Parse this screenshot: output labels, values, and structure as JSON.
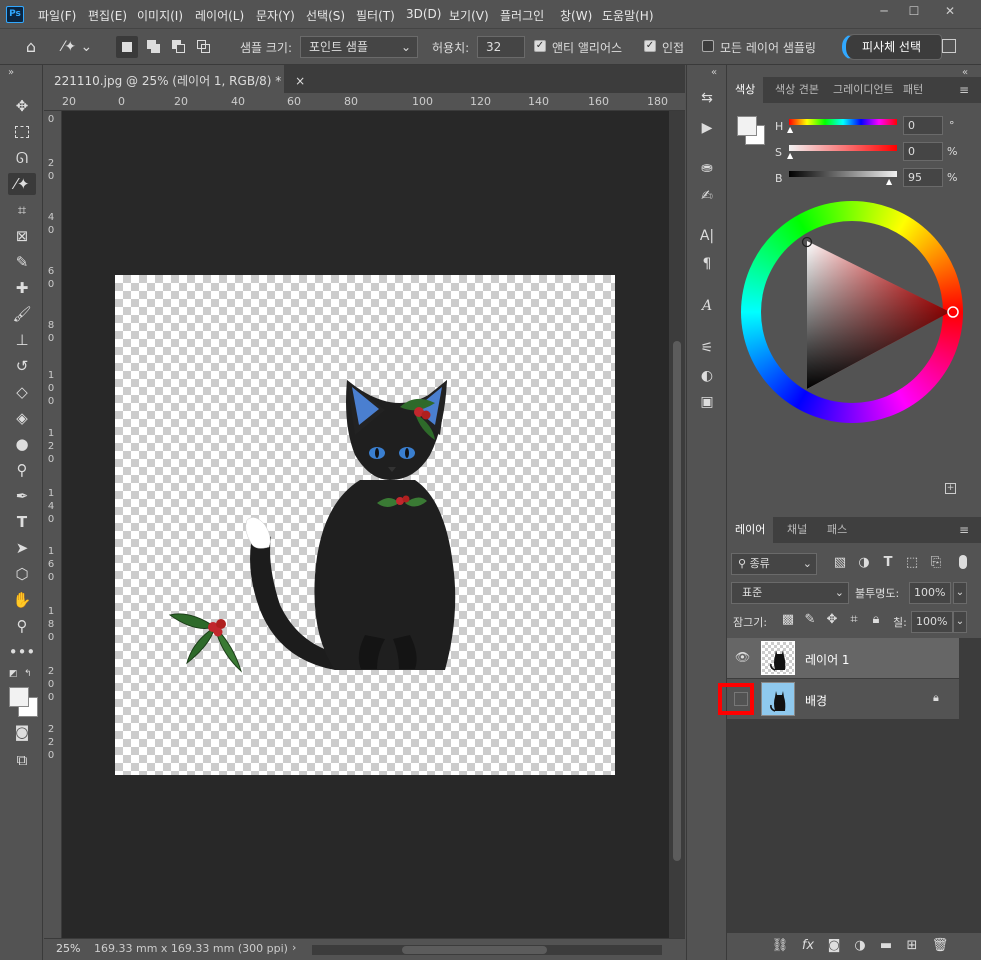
{
  "app": {
    "logo": "Ps"
  },
  "menu": [
    "파일(F)",
    "편집(E)",
    "이미지(I)",
    "레이어(L)",
    "문자(Y)",
    "선택(S)",
    "필터(T)",
    "3D(D)",
    "보기(V)",
    "플러그인",
    "창(W)",
    "도움말(H)"
  ],
  "window_controls": {
    "minimize": "─",
    "maximize": "☐",
    "close": "✕"
  },
  "options": {
    "sample_size_label": "샘플 크기:",
    "sample_size_value": "포인트 샘플",
    "tolerance_label": "허용치:",
    "tolerance_value": "32",
    "antialias_label": "앤티 앨리어스",
    "antialias_checked": true,
    "contiguous_label": "인접",
    "contiguous_checked": true,
    "sample_all_label": "모든 레이어 샘플링",
    "sample_all_checked": false,
    "subject_select_label": "피사체 선택"
  },
  "document": {
    "tab_title": "221110.jpg @ 25% (레이어 1, RGB/8) *",
    "close": "×",
    "zoom": "25%",
    "doc_size": "169.33 mm x 169.33 mm (300 ppi)"
  },
  "ruler_h": [
    "20",
    "0",
    "20",
    "40",
    "60",
    "80",
    "100",
    "120",
    "140",
    "160",
    "180"
  ],
  "ruler_v": [
    "0",
    "2\n0",
    "4\n0",
    "6\n0",
    "8\n0",
    "1\n0\n0",
    "1\n2\n0",
    "1\n4\n0",
    "1\n6\n0",
    "1\n8\n0",
    "2\n0\n0",
    "2\n2\n0"
  ],
  "color_panel": {
    "tabs": [
      "색상",
      "색상 견본",
      "그레이디언트",
      "패턴"
    ],
    "active_tab": 0,
    "h_label": "H",
    "h_value": "0",
    "h_unit": "°",
    "s_label": "S",
    "s_value": "0",
    "s_unit": "%",
    "b_label": "B",
    "b_value": "95",
    "b_unit": "%"
  },
  "layers_panel": {
    "tabs": [
      "레이어",
      "채널",
      "패스"
    ],
    "active_tab": 0,
    "filter_label": "종류",
    "blend_mode": "표준",
    "opacity_label": "불투명도:",
    "opacity_value": "100%",
    "lock_label": "잠그기:",
    "fill_label": "칠:",
    "fill_value": "100%",
    "layers": [
      {
        "name": "레이어 1",
        "visible": true,
        "selected": true,
        "locked": false
      },
      {
        "name": "배경",
        "visible": false,
        "selected": false,
        "locked": true
      }
    ]
  },
  "colors": {
    "accent": "#31a8ff",
    "highlight_box": "#ff0000",
    "foreground": "#f2f2f2",
    "background": "#ffffff"
  }
}
